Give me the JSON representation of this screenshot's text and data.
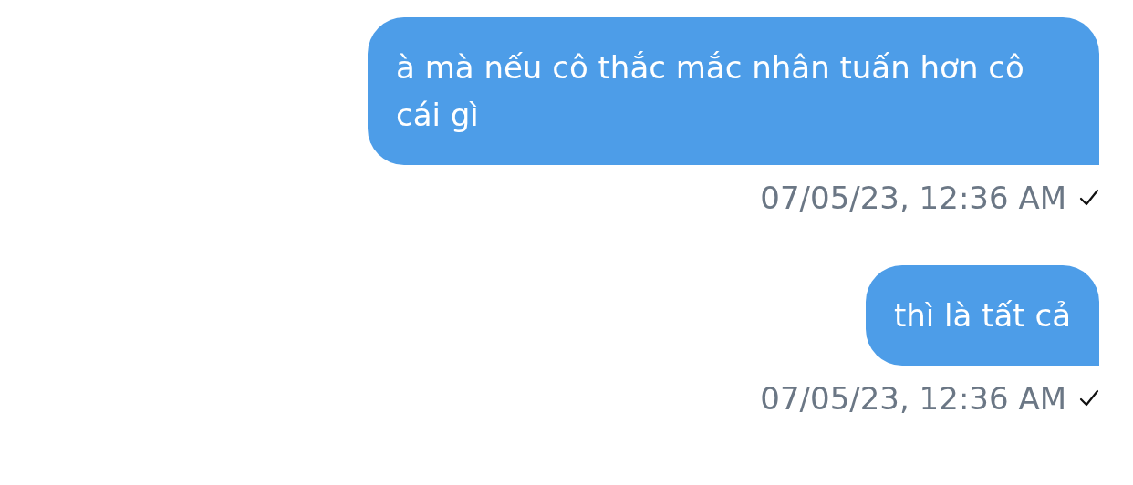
{
  "messages": [
    {
      "text": "à mà nếu cô thắc mắc nhân tuấn hơn cô cái gì",
      "timestamp": "07/05/23, 12:36 AM",
      "sent": true
    },
    {
      "text": "thì là tất cả",
      "timestamp": "07/05/23, 12:36 AM",
      "sent": true
    }
  ]
}
